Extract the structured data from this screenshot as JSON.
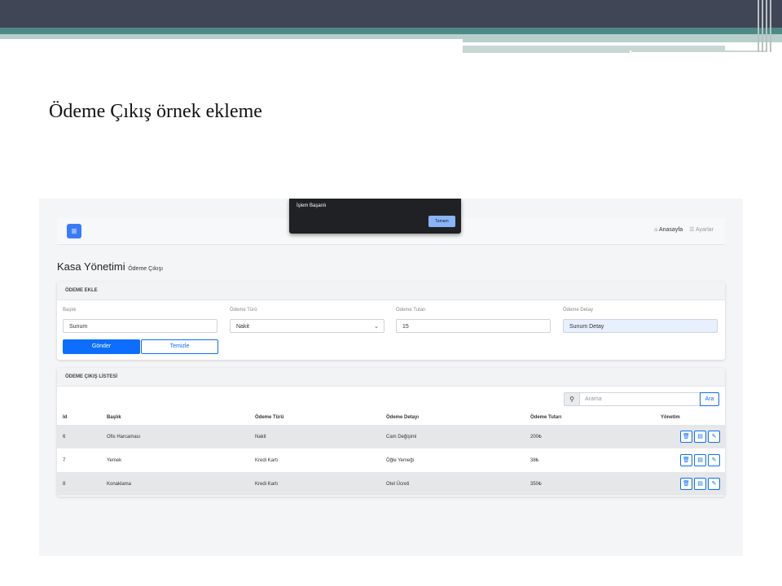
{
  "slide": {
    "title": "Ödeme Çıkış örnek ekleme"
  },
  "toast": {
    "message": "İşlem Başarılı",
    "button": "Tamam"
  },
  "navbar": {
    "menu_icon": "menu-icon",
    "home_icon": "home-icon",
    "home_label": "Anasayfa",
    "settings_icon": "settings-icon",
    "settings_label": "Ayarlar"
  },
  "page": {
    "title": "Kasa Yönetimi",
    "subtitle": "Ödeme Çıkışı"
  },
  "form": {
    "header": "ÖDEME EKLE",
    "fields": [
      {
        "label": "Başlık",
        "value": "Sunum"
      },
      {
        "label": "Ödeme Türü",
        "value": "Nakit"
      },
      {
        "label": "Ödeme Tutarı",
        "value": "15"
      },
      {
        "label": "Ödeme Detay",
        "value": "Sunum Detay"
      }
    ],
    "submit": "Gönder",
    "clear": "Temizle"
  },
  "list": {
    "header": "ÖDEME ÇIKIŞ LİSTESİ",
    "search_placeholder": "Arama",
    "search_button": "Ara",
    "columns": [
      "Id",
      "Başlık",
      "Ödeme Türü",
      "Ödeme Detayı",
      "Ödeme Tutarı",
      "Yönetim"
    ],
    "rows": [
      [
        "6",
        "Ofis Harcaması",
        "Nakit",
        "Cam Değişimi",
        "200₺"
      ],
      [
        "7",
        "Yemek",
        "Kredi Kartı",
        "Öğle Yemeği",
        "38₺"
      ],
      [
        "8",
        "Konaklama",
        "Kredi Kartı",
        "Otel Ücreti",
        "350₺"
      ]
    ],
    "row_actions": [
      "trash-icon",
      "document-icon",
      "pencil-icon"
    ]
  },
  "colors": {
    "primary": "#0d6efd",
    "navbar_button": "#3b7bf6",
    "slide_top": "#414657",
    "slide_teal": "#4d8a85"
  }
}
